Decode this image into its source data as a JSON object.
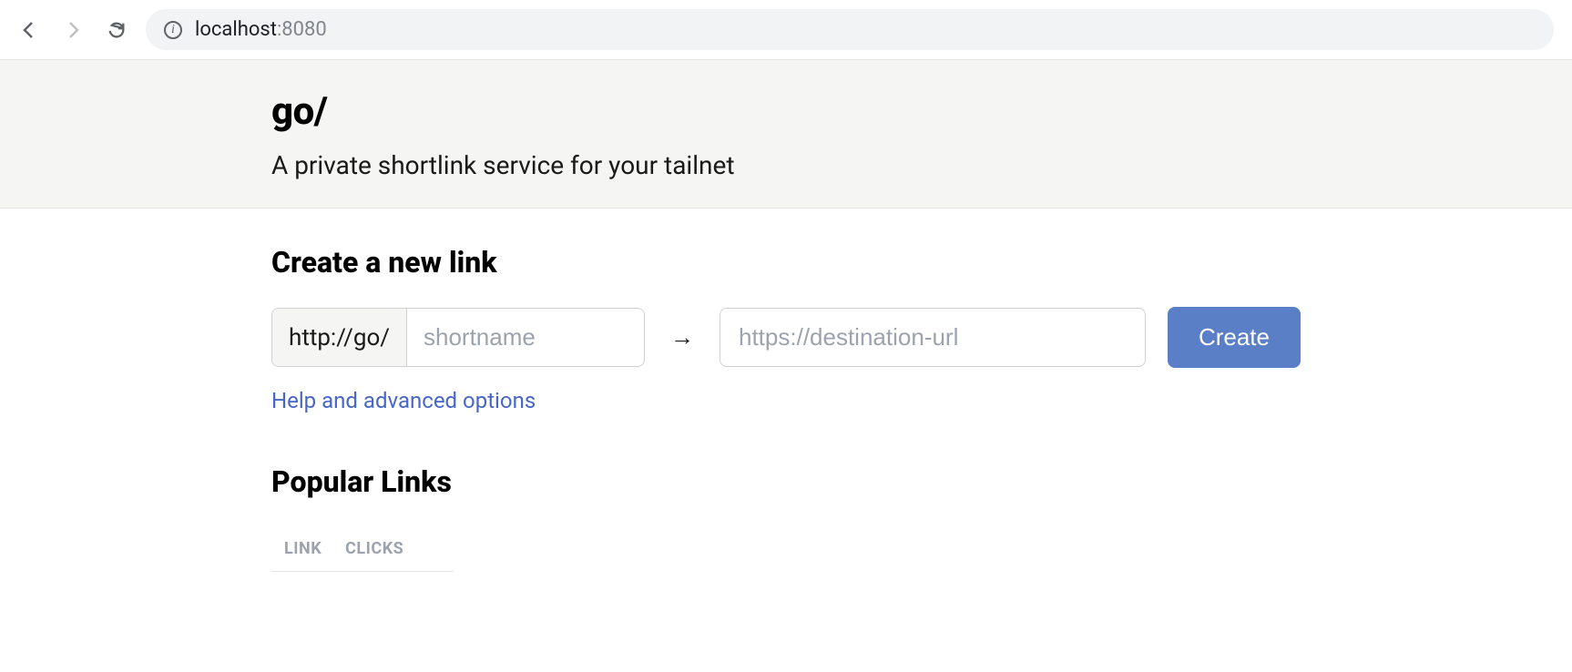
{
  "browser": {
    "url_host": "localhost",
    "url_port": ":8080"
  },
  "header": {
    "title": "go/",
    "subtitle": "A private shortlink service for your tailnet"
  },
  "create": {
    "heading": "Create a new link",
    "prefix": "http://go/",
    "shortname_placeholder": "shortname",
    "arrow": "→",
    "dest_placeholder": "https://destination-url",
    "button_label": "Create",
    "help_link": "Help and advanced options"
  },
  "popular": {
    "heading": "Popular Links",
    "columns": {
      "link": "LINK",
      "clicks": "CLICKS"
    }
  }
}
